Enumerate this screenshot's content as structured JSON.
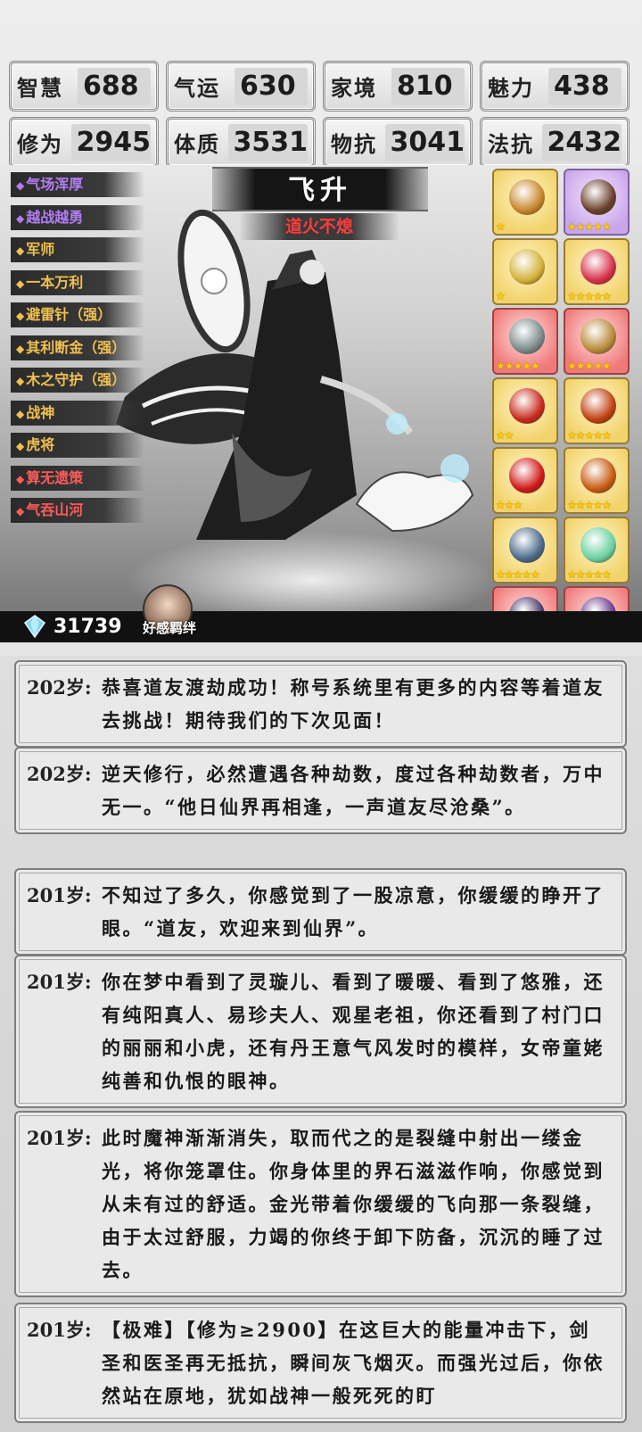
{
  "stats": [
    {
      "label": "智慧",
      "value": "688"
    },
    {
      "label": "气运",
      "value": "630"
    },
    {
      "label": "家境",
      "value": "810"
    },
    {
      "label": "魅力",
      "value": "438"
    },
    {
      "label": "修为",
      "value": "2945"
    },
    {
      "label": "体质",
      "value": "3531"
    },
    {
      "label": "物抗",
      "value": "3041"
    },
    {
      "label": "法抗",
      "value": "2432"
    }
  ],
  "skills": [
    {
      "label": "气场浑厚",
      "color": "purple"
    },
    {
      "label": "越战越勇",
      "color": "purple"
    },
    {
      "label": "军师",
      "color": "gold"
    },
    {
      "label": "一本万利",
      "color": "gold"
    },
    {
      "label": "避雷针（强）",
      "color": "gold"
    },
    {
      "label": "其利断金（强）",
      "color": "gold"
    },
    {
      "label": "木之守护（强）",
      "color": "gold"
    },
    {
      "label": "战神",
      "color": "gold"
    },
    {
      "label": "虎将",
      "color": "gold"
    },
    {
      "label": "算无遗策",
      "color": "red"
    },
    {
      "label": "气吞山河",
      "color": "red"
    }
  ],
  "hero": {
    "title": "飞升",
    "subtitle": "道火不熄"
  },
  "items": [
    {
      "name": "fan-icon",
      "frame": "gold",
      "stars": "★",
      "color": "#c8862a"
    },
    {
      "name": "crossbow-icon",
      "frame": "purple",
      "stars": "★★★★★",
      "color": "#6a3f2a"
    },
    {
      "name": "scepter-icon",
      "frame": "gold",
      "stars": "★",
      "color": "#d2b23a"
    },
    {
      "name": "bird-icon",
      "frame": "gold",
      "stars": "★★★★★",
      "color": "#d8304a"
    },
    {
      "name": "axe-icon",
      "frame": "red",
      "stars": "★★★★★",
      "color": "#7a8a8a"
    },
    {
      "name": "sword-icon",
      "frame": "red",
      "stars": "★★★★★",
      "color": "#b98a3a"
    },
    {
      "name": "phoenix-icon",
      "frame": "gold",
      "stars": "★★",
      "color": "#c82a1e"
    },
    {
      "name": "ring-icon",
      "frame": "gold",
      "stars": "★★★★★",
      "color": "#c04010"
    },
    {
      "name": "orb-icon",
      "frame": "gold",
      "stars": "★★★",
      "color": "#d01818"
    },
    {
      "name": "censer-icon",
      "frame": "gold",
      "stars": "★★★★★",
      "color": "#c85a10"
    },
    {
      "name": "dagger-icon",
      "frame": "gold",
      "stars": "★★★★★",
      "color": "#4a6a8a"
    },
    {
      "name": "crystal-icon",
      "frame": "gold",
      "stars": "★★★★★",
      "color": "#6ad0a0"
    },
    {
      "name": "mirror-icon",
      "frame": "red",
      "stars": "★★★★★",
      "color": "#4a3a6a"
    },
    {
      "name": "staff-icon",
      "frame": "red",
      "stars": "★★★★★",
      "color": "#6a3a8a"
    }
  ],
  "currency": {
    "amount": "31739"
  },
  "affinity": {
    "label": "好感羁绊"
  },
  "log": [
    {
      "age": "202岁:",
      "text": "恭喜道友渡劫成功！称号系统里有更多的内容等着道友去挑战！期待我们的下次见面！"
    },
    {
      "age": "202岁:",
      "text": "逆天修行，必然遭遇各种劫数，度过各种劫数者，万中无一。“他日仙界再相逢，一声道友尽沧桑”。"
    },
    {
      "age": "201岁:",
      "text": "不知过了多久，你感觉到了一股凉意，你缓缓的睁开了眼。“道友，欢迎来到仙界”。"
    },
    {
      "age": "201岁:",
      "text": "你在梦中看到了灵璇儿、看到了暖暖、看到了悠雅，还有纯阳真人、易珍夫人、观星老祖，你还看到了村门口的丽丽和小虎，还有丹王意气风发时的模样，女帝童姥纯善和仇恨的眼神。"
    },
    {
      "age": "201岁:",
      "text": "此时魔神渐渐消失，取而代之的是裂缝中射出一缕金光，将你笼罩住。你身体里的界石滋滋作响，你感觉到从未有过的舒适。金光带着你缓缓的飞向那一条裂缝，由于太过舒服，力竭的你终于卸下防备，沉沉的睡了过去。"
    },
    {
      "age": "201岁:",
      "text": "【极难】【修为≥2900】在这巨大的能量冲击下，剑圣和医圣再无抵抗，瞬间灰飞烟灭。而强光过后，你依然站在原地，犹如战神一般死死的盯"
    }
  ]
}
